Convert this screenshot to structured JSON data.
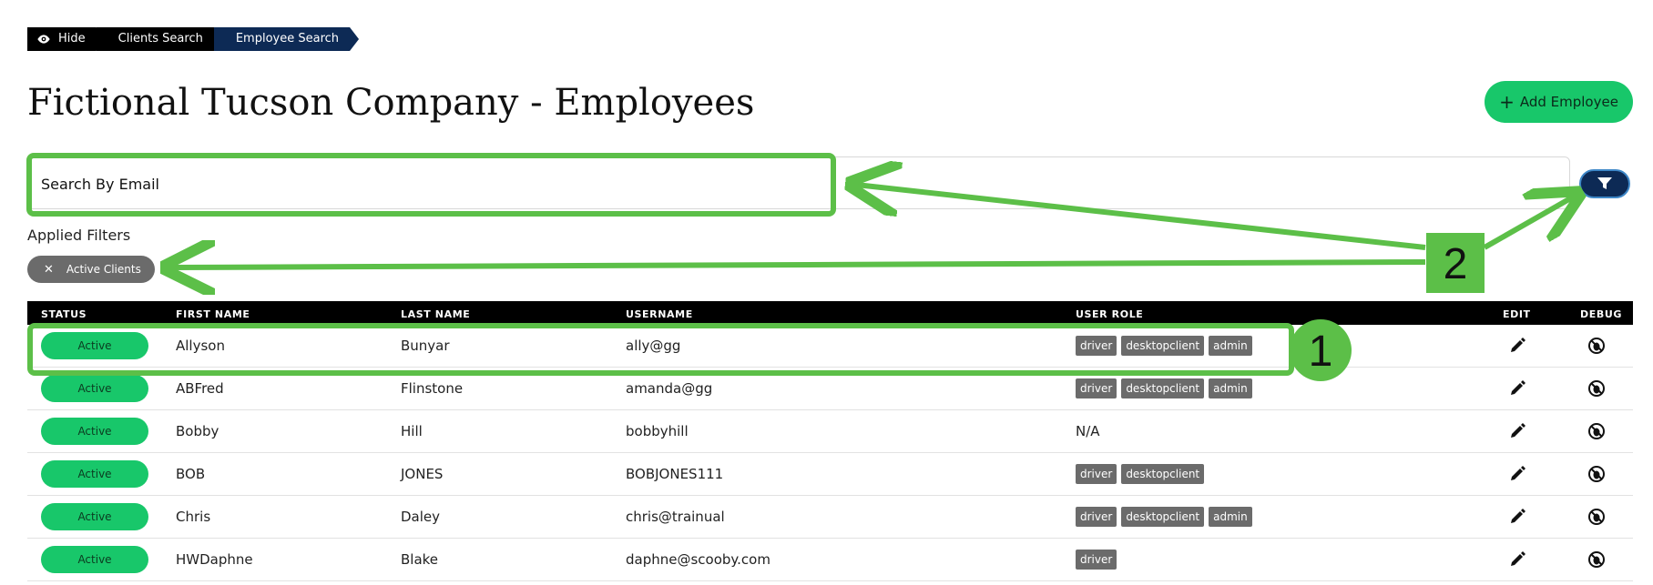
{
  "breadcrumb": {
    "hide": "Hide",
    "clients": "Clients Search",
    "employees": "Employee Search"
  },
  "page_title": "Fictional Tucson Company - Employees",
  "add_button": "Add Employee",
  "search": {
    "placeholder": "Search By Email",
    "value": ""
  },
  "filters": {
    "label": "Applied Filters",
    "chips": [
      "Active Clients"
    ]
  },
  "table": {
    "headers": [
      "STATUS",
      "FIRST NAME",
      "LAST NAME",
      "USERNAME",
      "USER ROLE",
      "EDIT",
      "DEBUG"
    ],
    "rows": [
      {
        "status": "Active",
        "first": "Allyson",
        "last": "Bunyar",
        "username": "ally@gg",
        "roles": [
          "driver",
          "desktopclient",
          "admin"
        ]
      },
      {
        "status": "Active",
        "first": "ABFred",
        "last": "Flinstone",
        "username": "amanda@gg",
        "roles": [
          "driver",
          "desktopclient",
          "admin"
        ]
      },
      {
        "status": "Active",
        "first": "Bobby",
        "last": "Hill",
        "username": "bobbyhill",
        "roles": [],
        "roles_text": "N/A"
      },
      {
        "status": "Active",
        "first": "BOB",
        "last": "JONES",
        "username": "BOBJONES111",
        "roles": [
          "driver",
          "desktopclient"
        ]
      },
      {
        "status": "Active",
        "first": "Chris",
        "last": "Daley",
        "username": "chris@trainual",
        "roles": [
          "driver",
          "desktopclient",
          "admin"
        ]
      },
      {
        "status": "Active",
        "first": "HWDaphne",
        "last": "Blake",
        "username": "daphne@scooby.com",
        "roles": [
          "driver"
        ]
      }
    ]
  },
  "annotations": {
    "label_1": "1",
    "label_2": "2"
  },
  "colors": {
    "accent": "#18c76a",
    "navy": "#0d2a55",
    "annotation": "#5cbf48",
    "chip": "#6b6b6b"
  },
  "icons": {
    "eye": "eye-icon",
    "filter": "funnel-icon",
    "edit": "pencil-icon",
    "debug": "bug-off-icon"
  }
}
